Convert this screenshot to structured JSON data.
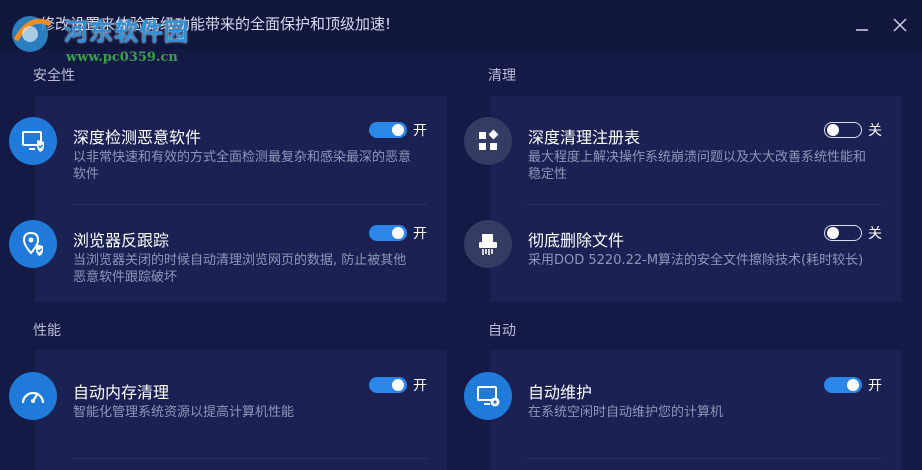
{
  "window": {
    "title": "修改设置来体验高级功能带来的全面保护和顶级加速!",
    "minimize_label": "minimize",
    "close_label": "close"
  },
  "watermark": {
    "name": "河东软件园",
    "url": "www.pc0359.cn"
  },
  "sections": [
    {
      "title": "安全性",
      "items": [
        {
          "title": "深度检测恶意软件",
          "desc": "以非常快速和有效的方式全面检测最复杂和感染最深的恶意软件",
          "toggle": "on",
          "toggle_label": "开",
          "icon": "monitor-shield-icon"
        },
        {
          "title": "浏览器反跟踪",
          "desc": "当浏览器关闭的时候自动清理浏览网页的数据, 防止被其他恶意软件跟踪破坏",
          "toggle": "on",
          "toggle_label": "开",
          "icon": "location-shield-icon"
        }
      ]
    },
    {
      "title": "清理",
      "items": [
        {
          "title": "深度清理注册表",
          "desc": "最大程度上解决操作系统崩溃问题以及大大改善系统性能和稳定性",
          "toggle": "off",
          "toggle_label": "关",
          "icon": "registry-icon"
        },
        {
          "title": "彻底删除文件",
          "desc": "采用DOD 5220.22-M算法的安全文件擦除技术(耗时较长)",
          "toggle": "off",
          "toggle_label": "关",
          "icon": "shredder-icon"
        }
      ]
    },
    {
      "title": "性能",
      "items": [
        {
          "title": "自动内存清理",
          "desc": "智能化管理系统资源以提高计算机性能",
          "toggle": "on",
          "toggle_label": "开",
          "icon": "speedometer-icon"
        }
      ]
    },
    {
      "title": "自动",
      "items": [
        {
          "title": "自动维护",
          "desc": "在系统空闲时自动维护您的计算机",
          "toggle": "on",
          "toggle_label": "开",
          "icon": "monitor-gear-icon"
        }
      ]
    }
  ],
  "colors": {
    "background": "#141a45",
    "panel": "#1b2152",
    "accent": "#1f7ad9",
    "toggle_on": "#2a86e8"
  }
}
